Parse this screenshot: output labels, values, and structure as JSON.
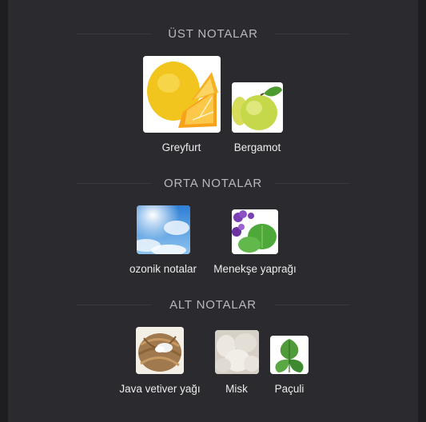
{
  "sections": [
    {
      "title": "ÜST NOTALAR",
      "notes": [
        {
          "name": "Greyfurt",
          "icon": "grapefruit-image"
        },
        {
          "name": "Bergamot",
          "icon": "bergamot-image"
        }
      ]
    },
    {
      "title": "ORTA NOTALAR",
      "notes": [
        {
          "name": "ozonik notalar",
          "icon": "sky-image"
        },
        {
          "name": "Menekşe yaprağı",
          "icon": "violet-leaf-image"
        }
      ]
    },
    {
      "title": "ALT NOTALAR",
      "notes": [
        {
          "name": "Java vetiver yağı",
          "icon": "vetiver-root-image"
        },
        {
          "name": "Misk",
          "icon": "musk-image"
        },
        {
          "name": "Paçuli",
          "icon": "patchouli-leaf-image"
        }
      ]
    }
  ],
  "colors": {
    "background": "#1e1e21",
    "panel": "#2b2b2f",
    "title": "#b9b9bd",
    "label": "#ececec"
  }
}
